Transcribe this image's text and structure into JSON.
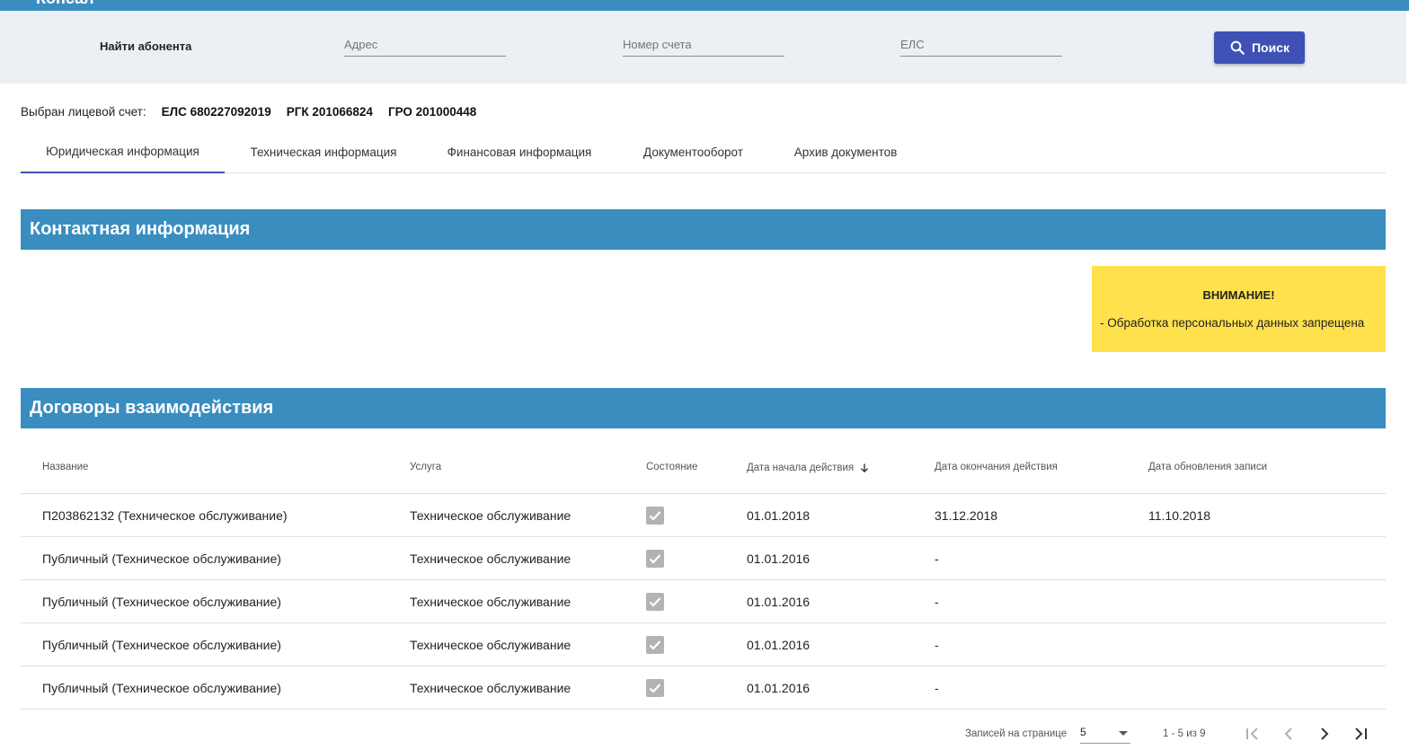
{
  "app": {
    "brand": "Консал"
  },
  "search": {
    "label": "Найти абонента",
    "address_placeholder": "Адрес",
    "account_placeholder": "Номер счета",
    "els_placeholder": "ЕЛС",
    "button_label": "Поиск"
  },
  "selected_account": {
    "label": "Выбран лицевой счет:",
    "els": "ЕЛС 680227092019",
    "rgk": "РГК 201066824",
    "gro": "ГРО 201000448"
  },
  "tabs": [
    {
      "label": "Юридическая информация",
      "active": true
    },
    {
      "label": "Техническая информация",
      "active": false
    },
    {
      "label": "Финансовая информация",
      "active": false
    },
    {
      "label": "Документооборот",
      "active": false
    },
    {
      "label": "Архив документов",
      "active": false
    }
  ],
  "contact_section": {
    "title": "Контактная информация"
  },
  "warning": {
    "title": "ВНИМАНИЕ!",
    "text": "- Обработка персональных данных запрещена"
  },
  "contracts_section": {
    "title": "Договоры взаимодействия"
  },
  "contracts_table": {
    "columns": [
      "Название",
      "Услуга",
      "Состояние",
      "Дата начала действия",
      "Дата окончания действия",
      "Дата обновления записи"
    ],
    "rows": [
      {
        "name": "П203862132 (Техническое обслуживание)",
        "service": "Техническое обслуживание",
        "active": true,
        "start": "01.01.2018",
        "end": "31.12.2018",
        "updated": "11.10.2018"
      },
      {
        "name": "Публичный (Техническое обслуживание)",
        "service": "Техническое обслуживание",
        "active": true,
        "start": "01.01.2016",
        "end": "-",
        "updated": ""
      },
      {
        "name": "Публичный (Техническое обслуживание)",
        "service": "Техническое обслуживание",
        "active": true,
        "start": "01.01.2016",
        "end": "-",
        "updated": ""
      },
      {
        "name": "Публичный (Техническое обслуживание)",
        "service": "Техническое обслуживание",
        "active": true,
        "start": "01.01.2016",
        "end": "-",
        "updated": ""
      },
      {
        "name": "Публичный (Техническое обслуживание)",
        "service": "Техническое обслуживание",
        "active": true,
        "start": "01.01.2016",
        "end": "-",
        "updated": ""
      }
    ]
  },
  "paginator": {
    "page_size_label": "Записей на странице",
    "page_size": "5",
    "range": "1 - 5 из 9"
  },
  "colors": {
    "header_blue": "#3a8dbf",
    "accent_indigo": "#3f51b5",
    "warning_yellow": "#ffe14d",
    "search_bg": "#eceff4"
  },
  "icons": {
    "search_button": "search-icon",
    "sort": "arrow-down-icon",
    "checkbox": "checkbox-checked-icon",
    "first_page": "first-page-icon",
    "prev_page": "chevron-left-icon",
    "next_page": "chevron-right-icon",
    "last_page": "last-page-icon"
  }
}
